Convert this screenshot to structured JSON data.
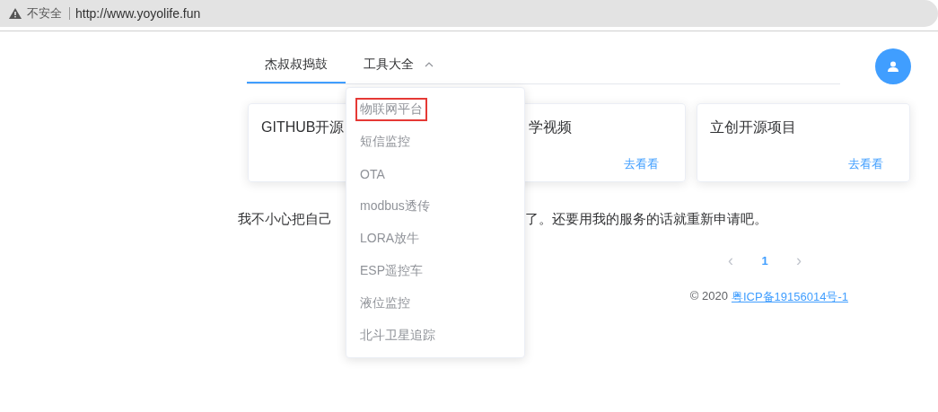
{
  "browser": {
    "security": "不安全",
    "url": "http://www.yoyolife.fun"
  },
  "nav": {
    "tabs": [
      {
        "label": "杰叔叔捣鼓",
        "selected": true,
        "kind": "plain"
      },
      {
        "label": "工具大全",
        "selected": false,
        "kind": "menu",
        "expanded": true
      }
    ]
  },
  "cards": [
    {
      "title": "GITHUB开源"
    },
    {
      "title": "学视频",
      "link": "去看看"
    },
    {
      "title": "立创开源项目",
      "link": "去看看"
    }
  ],
  "notice": [
    "我不小心把自己",
    "了。还要用我的服务的话就重新申请吧。"
  ],
  "pagination": {
    "prev": "‹",
    "pages": [
      {
        "label": "1",
        "selected": true
      }
    ],
    "next": "›"
  },
  "footer": {
    "copyright": "© 2020",
    "link": "粤ICP备19156014号-1"
  },
  "dropdown": [
    {
      "label": "物联网平台",
      "highlighted": true
    },
    {
      "label": "短信监控",
      "highlighted": false
    },
    {
      "label": "OTA",
      "highlighted": false
    },
    {
      "label": "modbus透传",
      "highlighted": false
    },
    {
      "label": "LORA放牛",
      "highlighted": false
    },
    {
      "label": "ESP遥控车",
      "highlighted": false
    },
    {
      "label": "液位监控",
      "highlighted": false
    },
    {
      "label": "北斗卫星追踪",
      "highlighted": false
    }
  ]
}
